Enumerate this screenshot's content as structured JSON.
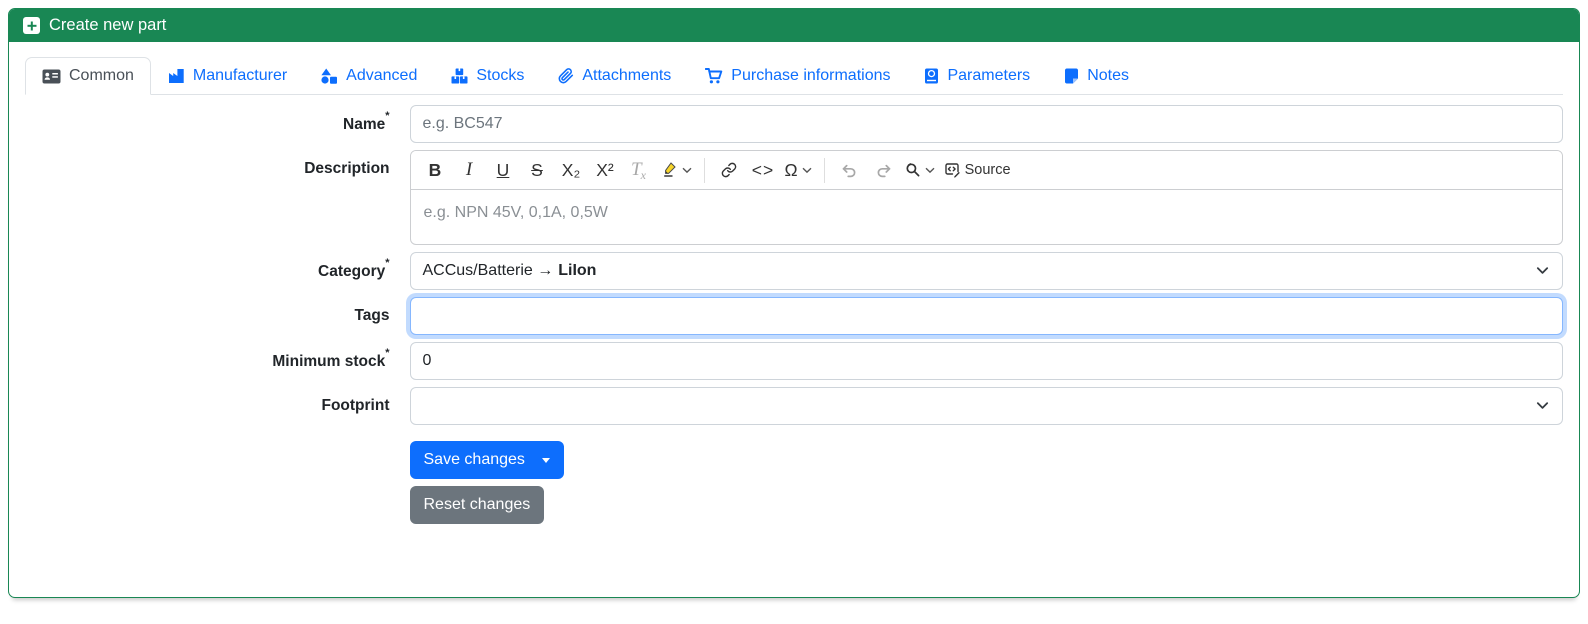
{
  "header": {
    "title": "Create new part"
  },
  "tabs": [
    {
      "label": "Common",
      "active": true
    },
    {
      "label": "Manufacturer"
    },
    {
      "label": "Advanced"
    },
    {
      "label": "Stocks"
    },
    {
      "label": "Attachments"
    },
    {
      "label": "Purchase informations"
    },
    {
      "label": "Parameters"
    },
    {
      "label": "Notes"
    }
  ],
  "form": {
    "name": {
      "label": "Name",
      "required": "*",
      "placeholder": "e.g. BC547"
    },
    "description": {
      "label": "Description",
      "placeholder": "e.g. NPN 45V, 0,1A, 0,5W"
    },
    "category": {
      "label": "Category",
      "required": "*",
      "value": "ACCus/Batterie →",
      "value_bold": "LiIon"
    },
    "tags": {
      "label": "Tags",
      "value": ""
    },
    "minimum_stock": {
      "label": "Minimum stock",
      "required": "*",
      "value": "0"
    },
    "footprint": {
      "label": "Footprint",
      "value": ""
    }
  },
  "editor": {
    "toolbar": {
      "bold": "B",
      "italic": "I",
      "underline": "U",
      "strikethrough": "S",
      "subscript": "X₂",
      "superscript": "X²",
      "remove_format_t": "T",
      "remove_format_x": "x",
      "code": "<>",
      "special_chars": "Ω",
      "source": "Source"
    }
  },
  "buttons": {
    "save": "Save changes",
    "reset": "Reset changes"
  },
  "colors": {
    "header_green": "#198754",
    "accent_blue": "#0d6efd",
    "reset_gray": "#6c757d",
    "highlight_yellow": "#f7d52a",
    "tab_active_text": "#495057",
    "input_border": "#ced4da",
    "focus_border": "#86b7fe"
  }
}
